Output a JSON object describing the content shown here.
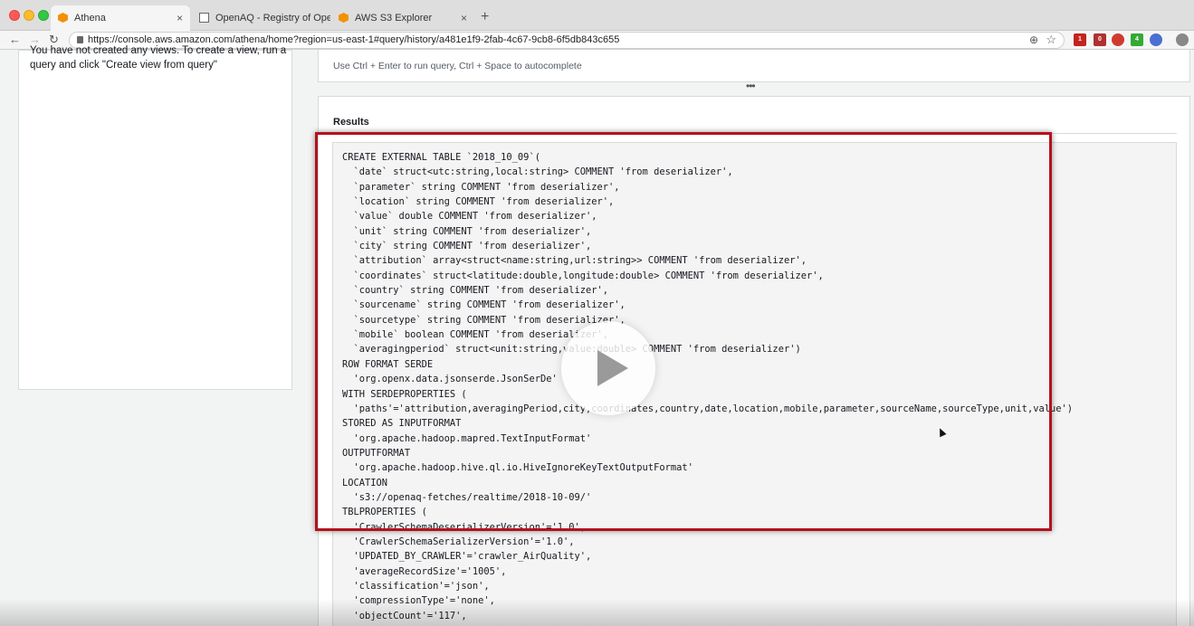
{
  "browser": {
    "tabs": [
      {
        "label": "Athena",
        "icon": "aws-icon",
        "active": true
      },
      {
        "label": "OpenAQ - Registry of Open Da",
        "icon": "document-icon",
        "active": false
      },
      {
        "label": "AWS S3 Explorer",
        "icon": "aws-icon",
        "active": false
      }
    ],
    "new_tab": "+",
    "close_glyph": "×",
    "url": "https://console.aws.amazon.com/athena/home?region=us-east-1#query/history/a481e1f9-2fab-4c67-9cb8-6f5db843c655",
    "ext_badges": [
      "1",
      "0",
      "4"
    ]
  },
  "left_panel": {
    "line1": "You have not created any views. To create a view, run a",
    "line2": "query and click \"Create view from query\""
  },
  "editor": {
    "hint": "Use Ctrl + Enter to run query, Ctrl + Space to autocomplete",
    "drag_handle": "•••"
  },
  "results": {
    "title": "Results",
    "lines": [
      "CREATE EXTERNAL TABLE `2018_10_09`(",
      "  `date` struct<utc:string,local:string> COMMENT 'from deserializer',",
      "  `parameter` string COMMENT 'from deserializer',",
      "  `location` string COMMENT 'from deserializer',",
      "  `value` double COMMENT 'from deserializer',",
      "  `unit` string COMMENT 'from deserializer',",
      "  `city` string COMMENT 'from deserializer',",
      "  `attribution` array<struct<name:string,url:string>> COMMENT 'from deserializer',",
      "  `coordinates` struct<latitude:double,longitude:double> COMMENT 'from deserializer',",
      "  `country` string COMMENT 'from deserializer',",
      "  `sourcename` string COMMENT 'from deserializer',",
      "  `sourcetype` string COMMENT 'from deserializer',",
      "  `mobile` boolean COMMENT 'from deserializer',",
      "  `averagingperiod` struct<unit:string,value:double> COMMENT 'from deserializer')",
      "ROW FORMAT SERDE",
      "  'org.openx.data.jsonserde.JsonSerDe'",
      "WITH SERDEPROPERTIES (",
      "  'paths'='attribution,averagingPeriod,city,coordinates,country,date,location,mobile,parameter,sourceName,sourceType,unit,value')",
      "STORED AS INPUTFORMAT",
      "  'org.apache.hadoop.mapred.TextInputFormat'",
      "OUTPUTFORMAT",
      "  'org.apache.hadoop.hive.ql.io.HiveIgnoreKeyTextOutputFormat'",
      "LOCATION",
      "  's3://openaq-fetches/realtime/2018-10-09/'",
      "TBLPROPERTIES (",
      "  'CrawlerSchemaDeserializerVersion'='1.0',",
      "  'CrawlerSchemaSerializerVersion'='1.0',",
      "  'UPDATED_BY_CRAWLER'='crawler_AirQuality',",
      "  'averageRecordSize'='1005',",
      "  'classification'='json',",
      "  'compressionType'='none',",
      "  'objectCount'='117',"
    ]
  },
  "colors": {
    "highlight": "#b3121c",
    "aws_orange": "#f29100"
  }
}
